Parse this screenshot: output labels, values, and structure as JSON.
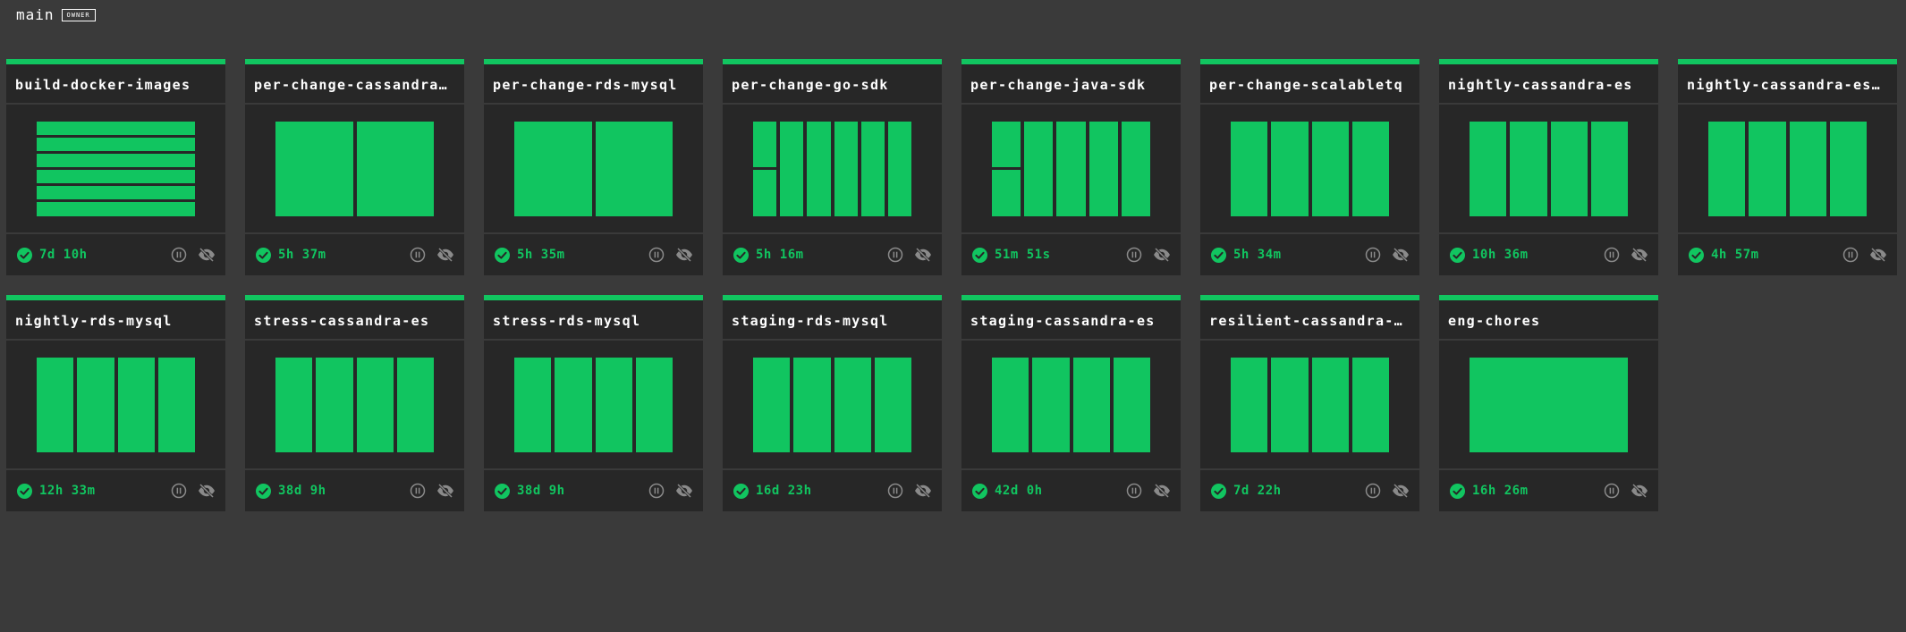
{
  "team": {
    "name": "main",
    "badge": "OWNER"
  },
  "colors": {
    "succeeded": "#11c560",
    "card": "#272727",
    "background": "#3a3a3a"
  },
  "pipelines": [
    {
      "name": "build-docker-images",
      "duration": "7d 10h",
      "layout": "rows",
      "jobs": [
        1,
        1,
        1,
        1,
        1,
        1
      ]
    },
    {
      "name": "per-change-cassandra-…",
      "duration": "5h 37m",
      "layout": "cols",
      "jobs": [
        1,
        1
      ]
    },
    {
      "name": "per-change-rds-mysql",
      "duration": "5h 35m",
      "layout": "cols",
      "jobs": [
        1,
        1
      ]
    },
    {
      "name": "per-change-go-sdk",
      "duration": "5h 16m",
      "layout": "cols",
      "jobs": [
        2,
        1,
        1,
        1,
        1,
        1
      ]
    },
    {
      "name": "per-change-java-sdk",
      "duration": "51m 51s",
      "layout": "cols",
      "jobs": [
        2,
        1,
        1,
        1,
        1
      ]
    },
    {
      "name": "per-change-scalabletq",
      "duration": "5h 34m",
      "layout": "cols",
      "jobs": [
        1,
        1,
        1,
        1
      ]
    },
    {
      "name": "nightly-cassandra-es",
      "duration": "10h 36m",
      "layout": "cols",
      "jobs": [
        1,
        1,
        1,
        1
      ]
    },
    {
      "name": "nightly-cassandra-es-…",
      "duration": "4h 57m",
      "layout": "cols",
      "jobs": [
        1,
        1,
        1,
        1
      ]
    },
    {
      "name": "nightly-rds-mysql",
      "duration": "12h 33m",
      "layout": "cols",
      "jobs": [
        1,
        1,
        1,
        1
      ]
    },
    {
      "name": "stress-cassandra-es",
      "duration": "38d 9h",
      "layout": "cols",
      "jobs": [
        1,
        1,
        1,
        1
      ]
    },
    {
      "name": "stress-rds-mysql",
      "duration": "38d 9h",
      "layout": "cols",
      "jobs": [
        1,
        1,
        1,
        1
      ]
    },
    {
      "name": "staging-rds-mysql",
      "duration": "16d 23h",
      "layout": "cols",
      "jobs": [
        1,
        1,
        1,
        1
      ]
    },
    {
      "name": "staging-cassandra-es",
      "duration": "42d 0h",
      "layout": "cols",
      "jobs": [
        1,
        1,
        1,
        1
      ]
    },
    {
      "name": "resilient-cassandra-es",
      "duration": "7d 22h",
      "layout": "cols",
      "jobs": [
        1,
        1,
        1,
        1
      ]
    },
    {
      "name": "eng-chores",
      "duration": "16h 26m",
      "layout": "cols",
      "jobs": [
        1
      ]
    }
  ],
  "icons": {
    "status": "check-circle-icon",
    "pause": "pause-circle-icon",
    "visibility": "eye-slash-icon"
  }
}
